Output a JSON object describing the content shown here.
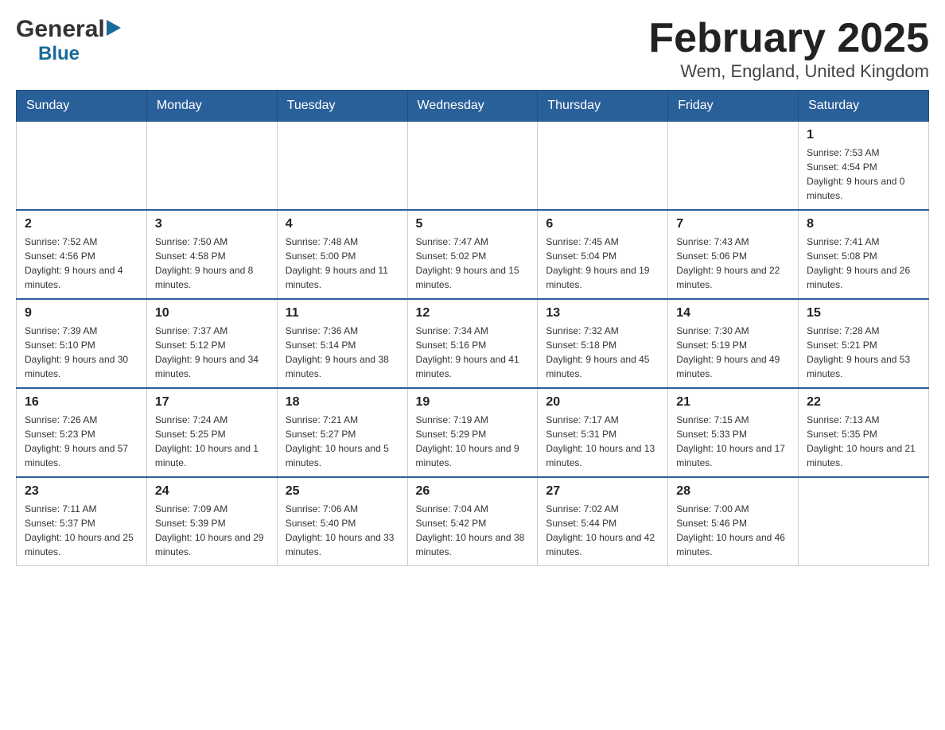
{
  "logo": {
    "general": "General",
    "triangle": "▶",
    "blue": "Blue"
  },
  "title": "February 2025",
  "subtitle": "Wem, England, United Kingdom",
  "days_of_week": [
    "Sunday",
    "Monday",
    "Tuesday",
    "Wednesday",
    "Thursday",
    "Friday",
    "Saturday"
  ],
  "weeks": [
    [
      {
        "day": "",
        "info": ""
      },
      {
        "day": "",
        "info": ""
      },
      {
        "day": "",
        "info": ""
      },
      {
        "day": "",
        "info": ""
      },
      {
        "day": "",
        "info": ""
      },
      {
        "day": "",
        "info": ""
      },
      {
        "day": "1",
        "info": "Sunrise: 7:53 AM\nSunset: 4:54 PM\nDaylight: 9 hours and 0 minutes."
      }
    ],
    [
      {
        "day": "2",
        "info": "Sunrise: 7:52 AM\nSunset: 4:56 PM\nDaylight: 9 hours and 4 minutes."
      },
      {
        "day": "3",
        "info": "Sunrise: 7:50 AM\nSunset: 4:58 PM\nDaylight: 9 hours and 8 minutes."
      },
      {
        "day": "4",
        "info": "Sunrise: 7:48 AM\nSunset: 5:00 PM\nDaylight: 9 hours and 11 minutes."
      },
      {
        "day": "5",
        "info": "Sunrise: 7:47 AM\nSunset: 5:02 PM\nDaylight: 9 hours and 15 minutes."
      },
      {
        "day": "6",
        "info": "Sunrise: 7:45 AM\nSunset: 5:04 PM\nDaylight: 9 hours and 19 minutes."
      },
      {
        "day": "7",
        "info": "Sunrise: 7:43 AM\nSunset: 5:06 PM\nDaylight: 9 hours and 22 minutes."
      },
      {
        "day": "8",
        "info": "Sunrise: 7:41 AM\nSunset: 5:08 PM\nDaylight: 9 hours and 26 minutes."
      }
    ],
    [
      {
        "day": "9",
        "info": "Sunrise: 7:39 AM\nSunset: 5:10 PM\nDaylight: 9 hours and 30 minutes."
      },
      {
        "day": "10",
        "info": "Sunrise: 7:37 AM\nSunset: 5:12 PM\nDaylight: 9 hours and 34 minutes."
      },
      {
        "day": "11",
        "info": "Sunrise: 7:36 AM\nSunset: 5:14 PM\nDaylight: 9 hours and 38 minutes."
      },
      {
        "day": "12",
        "info": "Sunrise: 7:34 AM\nSunset: 5:16 PM\nDaylight: 9 hours and 41 minutes."
      },
      {
        "day": "13",
        "info": "Sunrise: 7:32 AM\nSunset: 5:18 PM\nDaylight: 9 hours and 45 minutes."
      },
      {
        "day": "14",
        "info": "Sunrise: 7:30 AM\nSunset: 5:19 PM\nDaylight: 9 hours and 49 minutes."
      },
      {
        "day": "15",
        "info": "Sunrise: 7:28 AM\nSunset: 5:21 PM\nDaylight: 9 hours and 53 minutes."
      }
    ],
    [
      {
        "day": "16",
        "info": "Sunrise: 7:26 AM\nSunset: 5:23 PM\nDaylight: 9 hours and 57 minutes."
      },
      {
        "day": "17",
        "info": "Sunrise: 7:24 AM\nSunset: 5:25 PM\nDaylight: 10 hours and 1 minute."
      },
      {
        "day": "18",
        "info": "Sunrise: 7:21 AM\nSunset: 5:27 PM\nDaylight: 10 hours and 5 minutes."
      },
      {
        "day": "19",
        "info": "Sunrise: 7:19 AM\nSunset: 5:29 PM\nDaylight: 10 hours and 9 minutes."
      },
      {
        "day": "20",
        "info": "Sunrise: 7:17 AM\nSunset: 5:31 PM\nDaylight: 10 hours and 13 minutes."
      },
      {
        "day": "21",
        "info": "Sunrise: 7:15 AM\nSunset: 5:33 PM\nDaylight: 10 hours and 17 minutes."
      },
      {
        "day": "22",
        "info": "Sunrise: 7:13 AM\nSunset: 5:35 PM\nDaylight: 10 hours and 21 minutes."
      }
    ],
    [
      {
        "day": "23",
        "info": "Sunrise: 7:11 AM\nSunset: 5:37 PM\nDaylight: 10 hours and 25 minutes."
      },
      {
        "day": "24",
        "info": "Sunrise: 7:09 AM\nSunset: 5:39 PM\nDaylight: 10 hours and 29 minutes."
      },
      {
        "day": "25",
        "info": "Sunrise: 7:06 AM\nSunset: 5:40 PM\nDaylight: 10 hours and 33 minutes."
      },
      {
        "day": "26",
        "info": "Sunrise: 7:04 AM\nSunset: 5:42 PM\nDaylight: 10 hours and 38 minutes."
      },
      {
        "day": "27",
        "info": "Sunrise: 7:02 AM\nSunset: 5:44 PM\nDaylight: 10 hours and 42 minutes."
      },
      {
        "day": "28",
        "info": "Sunrise: 7:00 AM\nSunset: 5:46 PM\nDaylight: 10 hours and 46 minutes."
      },
      {
        "day": "",
        "info": ""
      }
    ]
  ]
}
